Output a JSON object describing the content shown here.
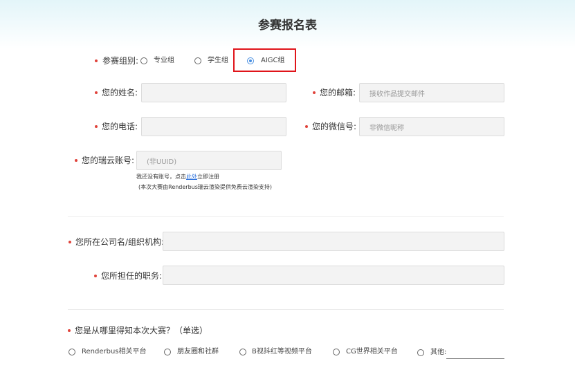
{
  "title": "参赛报名表",
  "group": {
    "label": "参赛组别:",
    "options": [
      "专业组",
      "学生组",
      "AIGC组"
    ],
    "selected": "AIGC组"
  },
  "name": {
    "label": "您的姓名:",
    "value": ""
  },
  "email": {
    "label": "您的邮箱:",
    "placeholder": "接收作品提交邮件"
  },
  "phone": {
    "label": "您的电话:",
    "value": ""
  },
  "wechat": {
    "label": "您的微信号:",
    "placeholder": "非微信昵称"
  },
  "account": {
    "label": "您的瑞云账号:",
    "placeholder": "(非UUID)",
    "hint_prefix": "我还没有账号，点击",
    "hint_link": "此处",
    "hint_suffix": "立即注册",
    "note": "(本次大赛由Renderbus瑞云渲染提供免费云渲染支持)"
  },
  "company": {
    "label": "您所在公司名/组织机构:",
    "value": ""
  },
  "position": {
    "label": "您所担任的职务:",
    "value": ""
  },
  "source": {
    "question": "您是从哪里得知本次大赛？（单选）",
    "options": [
      "Renderbus相关平台",
      "朋友圈和社群",
      "B视抖红等视频平台",
      "CG世界相关平台",
      "其他:"
    ]
  },
  "colors": {
    "required": "#e0433b",
    "highlight": "#e0141a",
    "accent": "#4a90e2"
  }
}
